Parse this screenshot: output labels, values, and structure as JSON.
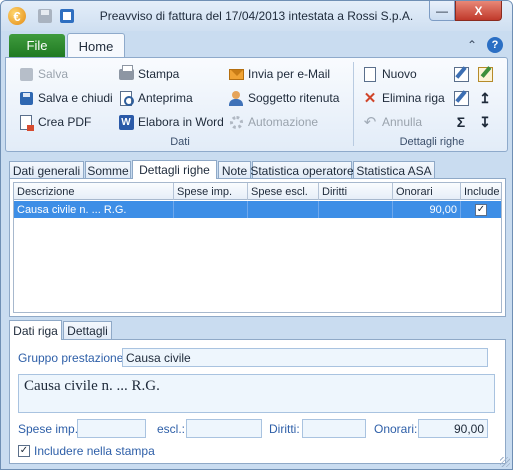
{
  "window": {
    "title": "Preavviso di fattura del 17/04/2013 intestata a Rossi S.p.A.",
    "app_icon_glyph": "€",
    "minimize_glyph": "—",
    "close_glyph": "X"
  },
  "ribbon": {
    "tabs": {
      "file": "File",
      "home": "Home"
    },
    "collapse_glyph": "⌃",
    "help_glyph": "?",
    "groups": {
      "dati": {
        "label": "Dati",
        "buttons": {
          "salva": "Salva",
          "salva_chiudi": "Salva e chiudi",
          "crea_pdf": "Crea PDF",
          "stampa": "Stampa",
          "anteprima": "Anteprima",
          "elabora_word": "Elabora in Word",
          "invia_email": "Invia per e-Mail",
          "soggetto_ritenuta": "Soggetto ritenuta",
          "automazione": "Automazione"
        }
      },
      "dettagli_righe": {
        "label": "Dettagli righe",
        "buttons": {
          "nuovo": "Nuovo",
          "elimina_riga": "Elimina riga",
          "annulla": "Annulla"
        },
        "glyphs": {
          "sigma": "Σ",
          "move_up": "↥",
          "move_down": "↧",
          "word": "W",
          "delete": "✕",
          "undo": "↶"
        }
      }
    }
  },
  "main_tabs": [
    "Dati generali",
    "Somme",
    "Dettagli righe",
    "Note",
    "Statistica operatore",
    "Statistica ASA"
  ],
  "grid": {
    "columns": [
      "Descrizione",
      "Spese imp.",
      "Spese escl.",
      "Diritti",
      "Onorari",
      "Include"
    ],
    "rows": [
      {
        "descrizione": "Causa civile n. ... R.G.",
        "spese_imp": "",
        "spese_escl": "",
        "diritti": "",
        "onorari": "90,00",
        "include": "✓"
      }
    ]
  },
  "detail_tabs": [
    "Dati riga",
    "Dettagli"
  ],
  "detail": {
    "gruppo_label": "Gruppo prestazione:",
    "gruppo_value": "Causa civile",
    "memo_text": "Causa civile n. ... R.G.",
    "spese_imp_label": "Spese imp.:",
    "spese_imp_value": "",
    "escl_label": "escl.:",
    "escl_value": "",
    "diritti_label": "Diritti:",
    "diritti_value": "",
    "onorari_label": "Onorari:",
    "onorari_value": "90,00",
    "includere_label": "Includere nella stampa",
    "includere_check": "✓"
  },
  "colors": {
    "accent_green": "#207a22",
    "selection_blue": "#3d8ee6",
    "label_blue": "#2e5fa8",
    "close_red": "#c0392b"
  }
}
